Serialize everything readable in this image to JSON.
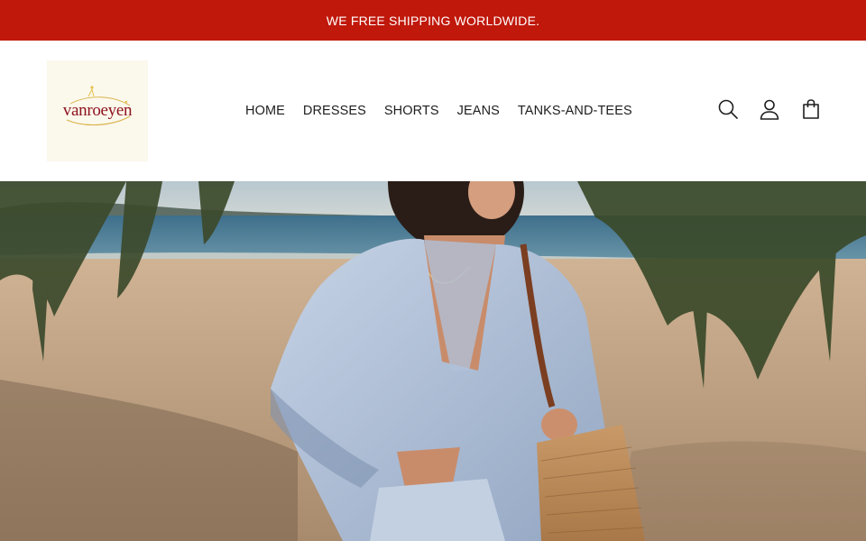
{
  "announcement": {
    "text": "WE FREE SHIPPING WORLDWIDE."
  },
  "brand": {
    "logo_text": "vanroeyen"
  },
  "nav": {
    "items": [
      {
        "label": "HOME"
      },
      {
        "label": "DRESSES"
      },
      {
        "label": "SHORTS"
      },
      {
        "label": "JEANS"
      },
      {
        "label": "TANKS-AND-TEES"
      }
    ]
  },
  "header_icons": [
    "search-icon",
    "account-icon",
    "cart-icon"
  ],
  "colors": {
    "announcement_bg": "#c0180b",
    "announcement_text": "#ffffff",
    "logo_accent": "#8e1420",
    "nav_text": "#1e1e1e"
  },
  "hero": {
    "image": "beach-lifestyle-photo"
  }
}
